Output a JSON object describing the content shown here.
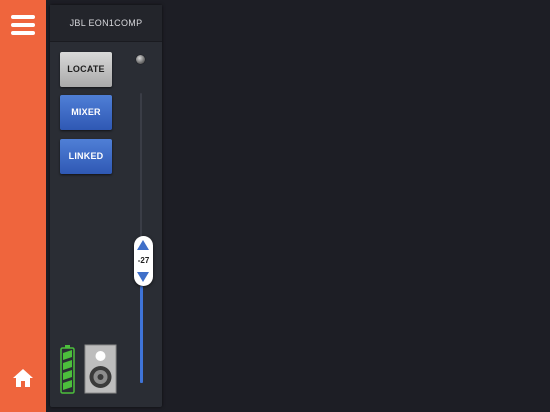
{
  "sidebar": {
    "menu_icon": "hamburger-menu-icon",
    "home_icon": "home-icon",
    "accent_color": "#ef653d"
  },
  "channel": {
    "device_name": "JBL EON1COMP",
    "buttons": {
      "locate": "LOCATE",
      "mixer": "MIXER",
      "linked": "LINKED"
    },
    "fader": {
      "value_label": "-27",
      "level_fraction": 0.42
    },
    "status_icons": {
      "battery": "battery-icon",
      "speaker": "speaker-icon"
    },
    "colors": {
      "button_active": "#3f6fd0",
      "button_locate": "#c4c4c4",
      "fader_fill": "#3f74d8"
    }
  }
}
